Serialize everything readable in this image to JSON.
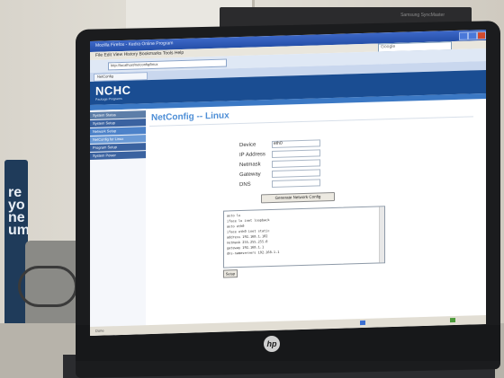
{
  "photo": {
    "background_monitor_label": "Samsung SyncMaster",
    "can_text": "re\nyo\nne\num",
    "laptop_logo": "hp"
  },
  "browser": {
    "title": "Mozilla Firefox - Kedra Online Program",
    "menu": "File  Edit  View  History  Bookmarks  Tools  Help",
    "search_placeholder": "Google",
    "address": "http://localhost/netconfig/linux",
    "tab_label": "NetConfig"
  },
  "site": {
    "logo": "NCHC",
    "logo_sub": "Package Programs",
    "sidebar": [
      {
        "label": "System Status",
        "color": "#5d7ea8"
      },
      {
        "label": "System Setup",
        "color": "#3a62a0"
      },
      {
        "label": "Network Setup",
        "color": "#4c82c9"
      },
      {
        "label": "NetConfig for Linux",
        "color": "#6a9ad6"
      },
      {
        "label": "Program Setup",
        "color": "#3a62a0"
      },
      {
        "label": "System Power",
        "color": "#3a62a0"
      }
    ],
    "heading": "NetConfig -- Linux",
    "form": {
      "labels": [
        "Device",
        "IP Address",
        "Netmask",
        "Gateway",
        "DNS"
      ],
      "values": [
        "eth0",
        "",
        "",
        "",
        ""
      ],
      "generate_button": "Generate Network Config"
    },
    "output_lines": [
      "auto lo",
      "iface lo inet loopback",
      "auto eth0",
      "iface eth0 inet static",
      "address 192.168.1.102",
      "netmask 255.255.255.0",
      "gateway 192.168.1.1",
      "dns-nameservers 192.168.1.1"
    ],
    "apply_button": "Setup"
  },
  "status": {
    "text": "Done"
  }
}
